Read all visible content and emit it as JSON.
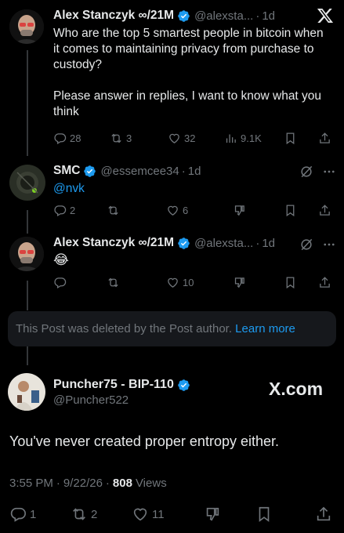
{
  "tweet1": {
    "name": "Alex Stanczyk ∞/21M",
    "handle": "@alexsta...",
    "time": "1d",
    "text": "Who are the top 5 smartest people in bitcoin when it comes to maintaining privacy from purchase to custody?\n\nPlease answer in replies, I want to know what you think",
    "replies": "28",
    "reposts": "3",
    "likes": "32",
    "views": "9.1K"
  },
  "tweet2": {
    "name": "SMC",
    "handle": "@essemcee34",
    "time": "1d",
    "mention": "@nvk",
    "replies": "2",
    "likes": "6"
  },
  "tweet3": {
    "name": "Alex Stanczyk ∞/21M",
    "handle": "@alexsta...",
    "time": "1d",
    "text": "😂",
    "likes": "10"
  },
  "deleted": {
    "text": "This Post was deleted by the Post author.",
    "link": "Learn more"
  },
  "main": {
    "name": "Puncher75 - BIP-110",
    "handle": "@Puncher522",
    "watermark": "X.com",
    "text": "You've never created proper entropy either.",
    "time": "3:55 PM",
    "date": "9/22/26",
    "views_count": "808",
    "views_label": "Views",
    "replies": "1",
    "reposts": "2",
    "likes": "11"
  },
  "icons": {
    "close": "x-logo-icon",
    "reply": "reply-icon",
    "repost": "repost-icon",
    "like": "heart-icon",
    "views": "views-icon",
    "bookmark": "bookmark-icon",
    "share": "share-icon",
    "grok": "grok-icon",
    "more": "more-icon",
    "downvote": "downvote-icon"
  },
  "colors": {
    "background": "#000000",
    "text": "#e7e9ea",
    "muted": "#71767b",
    "link": "#1d9bf0",
    "verified": "#1d9bf0"
  }
}
